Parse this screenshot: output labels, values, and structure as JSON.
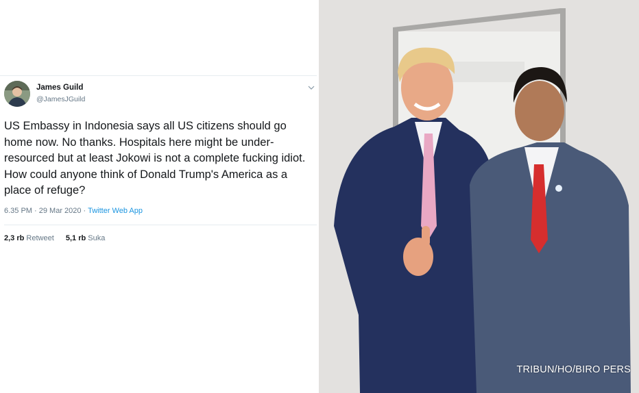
{
  "tweet": {
    "author_name": "James Guild",
    "author_handle": "@JamesJGuild",
    "text": "US Embassy in Indonesia says all US citizens should go home now. No thanks. Hospitals here might be under-resourced but at least Jokowi is not a complete fucking idiot. How could anyone think of Donald Trump's America as a place of refuge?",
    "time": "6.35 PM · 29 Mar 2020 · ",
    "source_app": "Twitter Web App",
    "retweet_count": "2,3 rb",
    "retweet_label": "Retweet",
    "like_count": "5,1 rb",
    "like_label": "Suka",
    "menu_icon": "chevron-down-icon"
  },
  "photo": {
    "credit": "TRIBUN/HO/BIRO PERS"
  },
  "colors": {
    "text": "#14171a",
    "secondary": "#657786",
    "link": "#1b95e0",
    "divider": "#e6ecf0"
  }
}
